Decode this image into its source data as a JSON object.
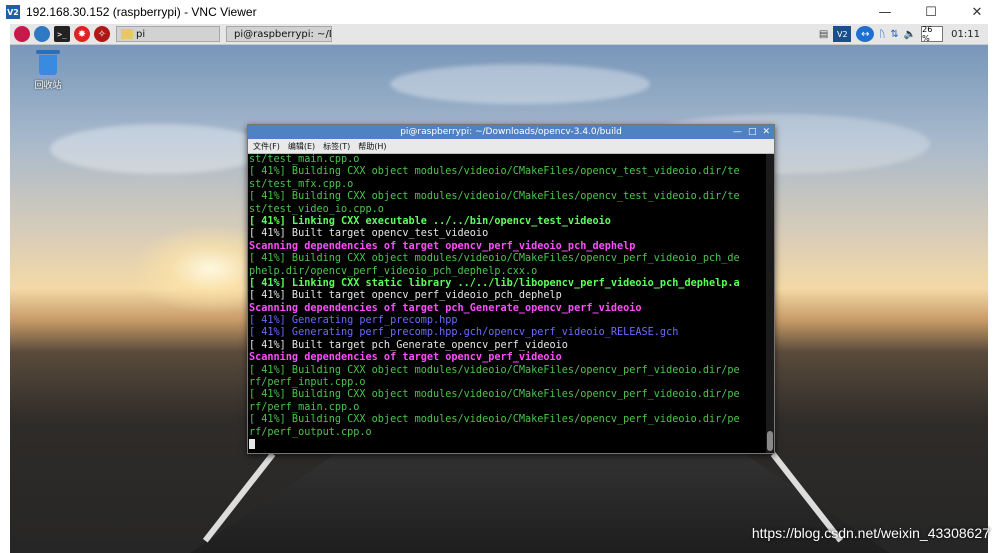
{
  "vnc_window": {
    "logo": "V2",
    "title": "192.168.30.152 (raspberrypi) - VNC Viewer",
    "controls": [
      "minimize-icon",
      "maximize-icon",
      "close-icon"
    ]
  },
  "pi_panel": {
    "launchers": [
      "raspberry-menu-icon",
      "web-browser-icon",
      "terminal-icon",
      "wolfram-icon",
      "mathematica-icon"
    ],
    "tasks": [
      {
        "label": "pi",
        "icon": "folder-icon"
      },
      {
        "label": "pi@raspberrypi: ~/Do...",
        "icon": "terminal-icon"
      }
    ],
    "tray": {
      "cpu": "26 %",
      "clock": "01:11"
    }
  },
  "desktop": {
    "trash_label": "回收站"
  },
  "terminal": {
    "title": "pi@raspberrypi: ~/Downloads/opencv-3.4.0/build",
    "menu": [
      "文件(F)",
      "编辑(E)",
      "标签(T)",
      "帮助(H)"
    ],
    "lines": [
      {
        "text": "st/test_main.cpp.o",
        "color": "green"
      },
      {
        "text": "[ 41%] Building CXX object modules/videoio/CMakeFiles/opencv_test_videoio.dir/te",
        "color": "green"
      },
      {
        "text": "st/test_mfx.cpp.o",
        "color": "green"
      },
      {
        "text": "[ 41%] Building CXX object modules/videoio/CMakeFiles/opencv_test_videoio.dir/te",
        "color": "green"
      },
      {
        "text": "st/test_video_io.cpp.o",
        "color": "green"
      },
      {
        "text": "[ 41%] Linking CXX executable ../../bin/opencv_test_videoio",
        "color": "bgreen"
      },
      {
        "text": "[ 41%] Built target opencv_test_videoio",
        "color": "white"
      },
      {
        "text": "Scanning dependencies of target opencv_perf_videoio_pch_dephelp",
        "color": "magenta"
      },
      {
        "text": "[ 41%] Building CXX object modules/videoio/CMakeFiles/opencv_perf_videoio_pch_de",
        "color": "green"
      },
      {
        "text": "phelp.dir/opencv_perf_videoio_pch_dephelp.cxx.o",
        "color": "green"
      },
      {
        "text": "[ 41%] Linking CXX static library ../../lib/libopencv_perf_videoio_pch_dephelp.a",
        "color": "bgreen"
      },
      {
        "text": "[ 41%] Built target opencv_perf_videoio_pch_dephelp",
        "color": "white"
      },
      {
        "text": "Scanning dependencies of target pch_Generate_opencv_perf_videoio",
        "color": "magenta"
      },
      {
        "text": "[ 41%] Generating perf_precomp.hpp",
        "color": "blue"
      },
      {
        "text": "[ 41%] Generating perf_precomp.hpp.gch/opencv_perf_videoio_RELEASE.gch",
        "color": "blue"
      },
      {
        "text": "[ 41%] Built target pch_Generate_opencv_perf_videoio",
        "color": "white"
      },
      {
        "text": "Scanning dependencies of target opencv_perf_videoio",
        "color": "magenta"
      },
      {
        "text": "[ 41%] Building CXX object modules/videoio/CMakeFiles/opencv_perf_videoio.dir/pe",
        "color": "green"
      },
      {
        "text": "rf/perf_input.cpp.o",
        "color": "green"
      },
      {
        "text": "[ 41%] Building CXX object modules/videoio/CMakeFiles/opencv_perf_videoio.dir/pe",
        "color": "green"
      },
      {
        "text": "rf/perf_main.cpp.o",
        "color": "green"
      },
      {
        "text": "[ 41%] Building CXX object modules/videoio/CMakeFiles/opencv_perf_videoio.dir/pe",
        "color": "green"
      },
      {
        "text": "rf/perf_output.cpp.o",
        "color": "green"
      }
    ]
  },
  "watermark": "https://blog.csdn.net/weixin_43308627"
}
